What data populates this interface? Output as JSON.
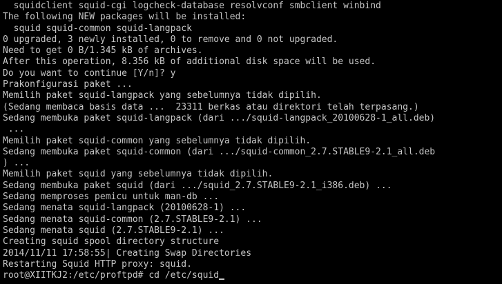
{
  "terminal": {
    "lines": [
      "  squidclient squid-cgi logcheck-database resolvconf smbclient winbind",
      "The following NEW packages will be installed:",
      "  squid squid-common squid-langpack",
      "0 upgraded, 3 newly installed, 0 to remove and 0 not upgraded.",
      "Need to get 0 B/1.345 kB of archives.",
      "After this operation, 8.356 kB of additional disk space will be used.",
      "Do you want to continue [Y/n]? y",
      "Prakonfigurasi paket ...",
      "Memilih paket squid-langpack yang sebelumnya tidak dipilih.",
      "(Sedang membaca basis data ...  23311 berkas atau direktori telah terpasang.)",
      "Sedang membuka paket squid-langpack (dari .../squid-langpack_20100628-1_all.deb)",
      " ...",
      "Memilih paket squid-common yang sebelumnya tidak dipilih.",
      "Sedang membuka paket squid-common (dari .../squid-common_2.7.STABLE9-2.1_all.deb",
      ") ...",
      "Memilih paket squid yang sebelumnya tidak dipilih.",
      "Sedang membuka paket squid (dari .../squid_2.7.STABLE9-2.1_i386.deb) ...",
      "Sedang memproses pemicu untuk man-db ...",
      "Sedang menata squid-langpack (20100628-1) ...",
      "Sedang menata squid-common (2.7.STABLE9-2.1) ...",
      "Sedang menata squid (2.7.STABLE9-2.1) ...",
      "Creating squid spool directory structure",
      "2014/11/11 17:58:55| Creating Swap Directories",
      "Restarting Squid HTTP proxy: squid."
    ],
    "prompt": {
      "text": "root@XIITKJ2:/etc/proftpd# cd /etc/squid"
    },
    "colors": {
      "background": "#000000",
      "foreground": "#c6c6c6"
    }
  }
}
